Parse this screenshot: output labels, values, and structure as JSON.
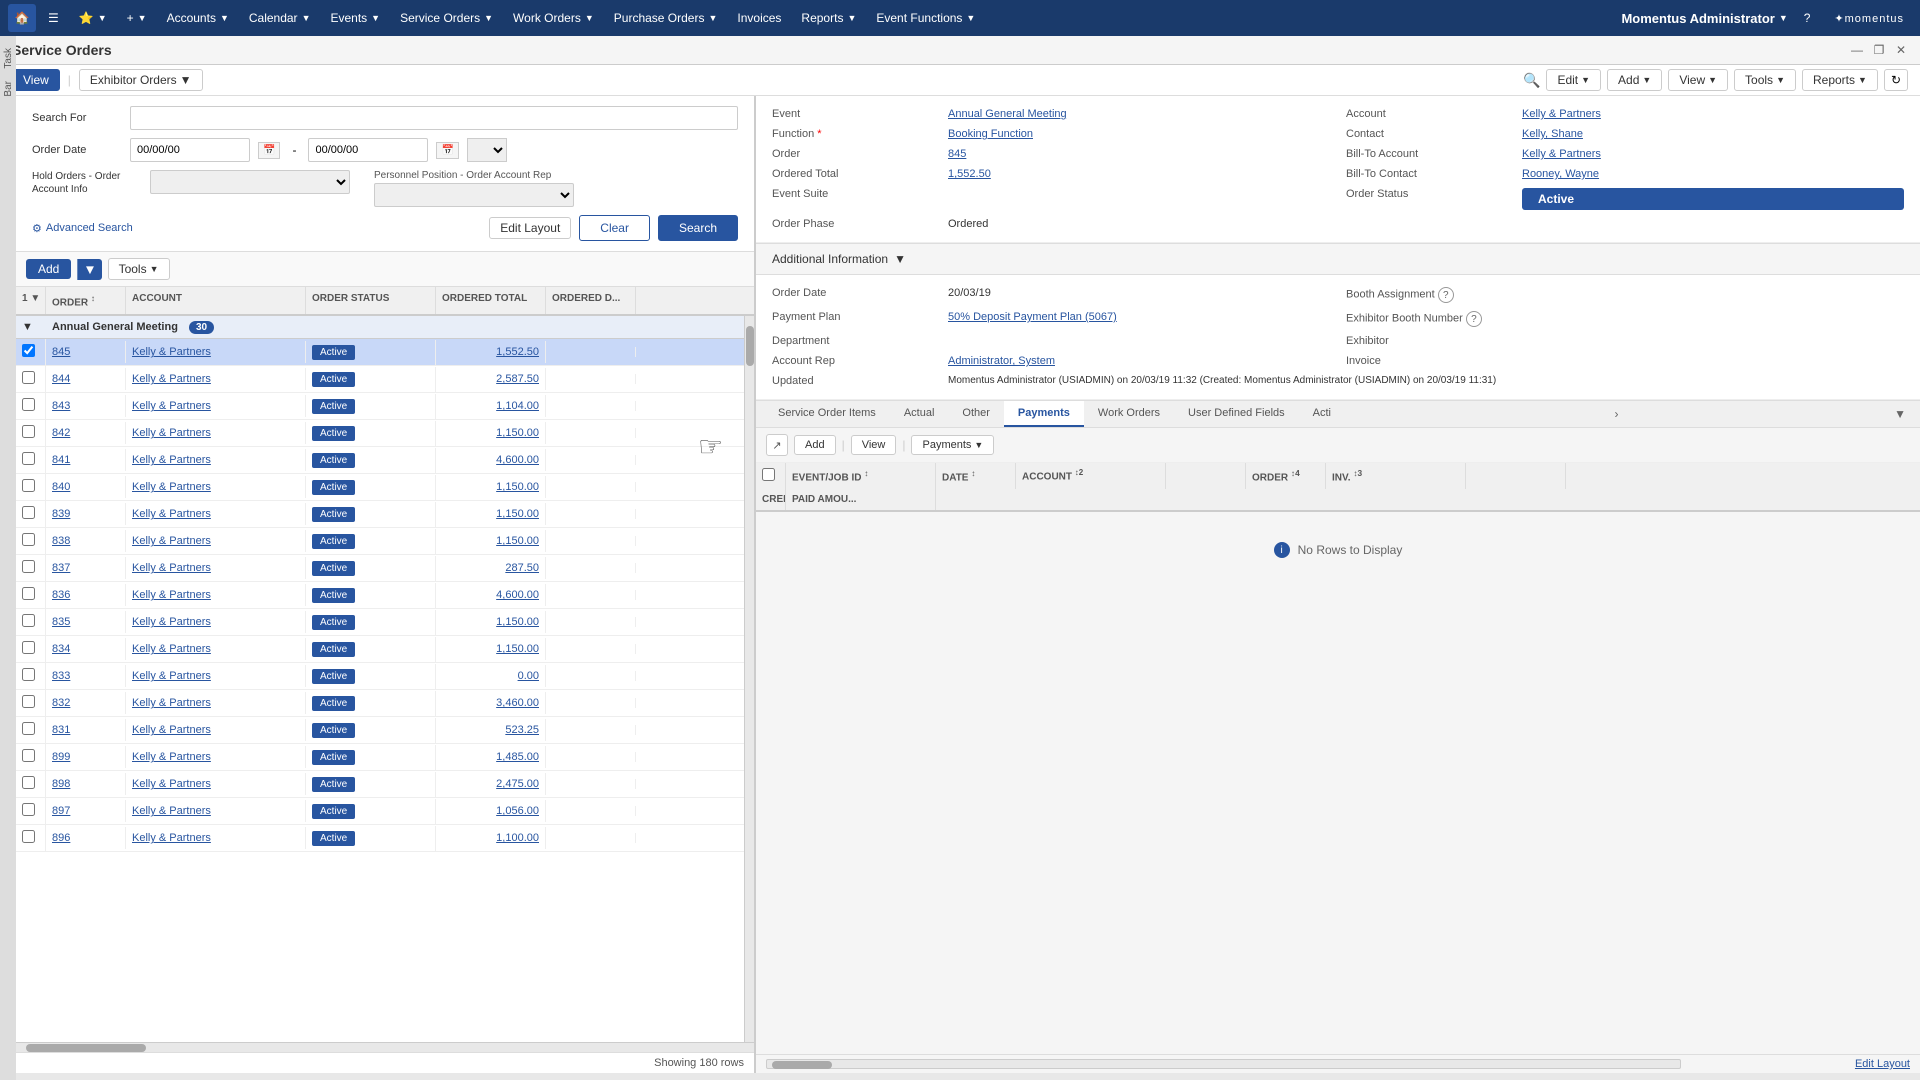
{
  "topNav": {
    "home_icon": "🏠",
    "star_icon": "⭐",
    "plus_icon": "+",
    "items": [
      {
        "label": "Accounts",
        "id": "accounts"
      },
      {
        "label": "Calendar",
        "id": "calendar"
      },
      {
        "label": "Events",
        "id": "events"
      },
      {
        "label": "Service Orders",
        "id": "service-orders"
      },
      {
        "label": "Work Orders",
        "id": "work-orders"
      },
      {
        "label": "Purchase Orders",
        "id": "purchase-orders"
      },
      {
        "label": "Invoices",
        "id": "invoices"
      },
      {
        "label": "Reports",
        "id": "reports"
      },
      {
        "label": "Event Functions",
        "id": "event-functions"
      }
    ],
    "admin_label": "Momentus Administrator",
    "help_icon": "?"
  },
  "window": {
    "title": "Service Orders",
    "view_label": "View",
    "pipe": "|",
    "exhibitor_orders_label": "Exhibitor Orders",
    "toolbar": {
      "edit": "Edit",
      "add": "Add",
      "view": "View",
      "tools": "Tools",
      "reports": "Reports",
      "refresh_icon": "↻"
    }
  },
  "search": {
    "search_for_label": "Search For",
    "order_date_label": "Order Date",
    "hold_orders_label": "Hold Orders - Order Account Info",
    "personnel_label": "Personnel Position - Order Account Rep",
    "date_from_placeholder": "00/00/00",
    "date_to_placeholder": "00/00/00",
    "advanced_search_label": "Advanced Search",
    "clear_label": "Clear",
    "search_label": "Search"
  },
  "resultsToolbar": {
    "add_label": "Add",
    "tools_label": "Tools"
  },
  "grid": {
    "columns": [
      "",
      "ORDER",
      "ACCOUNT",
      "ORDER STATUS",
      "ORDERED TOTAL",
      "ORDERED"
    ],
    "group": {
      "name": "Annual General Meeting",
      "count": "30"
    },
    "rows": [
      {
        "order": "845",
        "account": "Kelly & Partners",
        "status": "Active",
        "total": "1,552.50",
        "selected": true
      },
      {
        "order": "844",
        "account": "Kelly & Partners",
        "status": "Active",
        "total": "2,587.50",
        "selected": false
      },
      {
        "order": "843",
        "account": "Kelly & Partners",
        "status": "Active",
        "total": "1,104.00",
        "selected": false
      },
      {
        "order": "842",
        "account": "Kelly & Partners",
        "status": "Active",
        "total": "1,150.00",
        "selected": false
      },
      {
        "order": "841",
        "account": "Kelly & Partners",
        "status": "Active",
        "total": "4,600.00",
        "selected": false
      },
      {
        "order": "840",
        "account": "Kelly & Partners",
        "status": "Active",
        "total": "1,150.00",
        "selected": false
      },
      {
        "order": "839",
        "account": "Kelly & Partners",
        "status": "Active",
        "total": "1,150.00",
        "selected": false
      },
      {
        "order": "838",
        "account": "Kelly & Partners",
        "status": "Active",
        "total": "1,150.00",
        "selected": false
      },
      {
        "order": "837",
        "account": "Kelly & Partners",
        "status": "Active",
        "total": "287.50",
        "selected": false
      },
      {
        "order": "836",
        "account": "Kelly & Partners",
        "status": "Active",
        "total": "4,600.00",
        "selected": false
      },
      {
        "order": "835",
        "account": "Kelly & Partners",
        "status": "Active",
        "total": "1,150.00",
        "selected": false
      },
      {
        "order": "834",
        "account": "Kelly & Partners",
        "status": "Active",
        "total": "1,150.00",
        "selected": false
      },
      {
        "order": "833",
        "account": "Kelly & Partners",
        "status": "Active",
        "total": "0.00",
        "selected": false
      },
      {
        "order": "832",
        "account": "Kelly & Partners",
        "status": "Active",
        "total": "3,460.00",
        "selected": false
      },
      {
        "order": "831",
        "account": "Kelly & Partners",
        "status": "Active",
        "total": "523.25",
        "selected": false
      },
      {
        "order": "899",
        "account": "Kelly & Partners",
        "status": "Active",
        "total": "1,485.00",
        "selected": false
      },
      {
        "order": "898",
        "account": "Kelly & Partners",
        "status": "Active",
        "total": "2,475.00",
        "selected": false
      },
      {
        "order": "897",
        "account": "Kelly & Partners",
        "status": "Active",
        "total": "1,056.00",
        "selected": false
      },
      {
        "order": "896",
        "account": "Kelly & Partners",
        "status": "Active",
        "total": "1,100.00",
        "selected": false
      }
    ],
    "showing_rows": "Showing 180 rows"
  },
  "detail": {
    "event_label": "Event",
    "event_value": "Annual General Meeting",
    "function_label": "Function",
    "function_value": "Booking Function",
    "order_label": "Order",
    "order_value": "845",
    "ordered_total_label": "Ordered Total",
    "ordered_total_value": "1,552.50",
    "event_suite_label": "Event Suite",
    "event_suite_value": "",
    "order_phase_label": "Order Phase",
    "order_phase_value": "Ordered",
    "account_label": "Account",
    "account_value": "Kelly & Partners",
    "contact_label": "Contact",
    "contact_value": "Kelly, Shane",
    "bill_to_account_label": "Bill-To Account",
    "bill_to_account_value": "Kelly & Partners",
    "bill_to_contact_label": "Bill-To Contact",
    "bill_to_contact_value": "Rooney, Wayne",
    "order_status_label": "Order Status",
    "order_status_value": "Active"
  },
  "additionalInfo": {
    "header": "Additional Information",
    "order_date_label": "Order Date",
    "order_date_value": "20/03/19",
    "booth_assignment_label": "Booth Assignment",
    "payment_plan_label": "Payment Plan",
    "payment_plan_value": "50% Deposit Payment Plan (5067)",
    "exhibitor_booth_label": "Exhibitor Booth Number",
    "department_label": "Department",
    "department_value": "",
    "exhibitor_label": "Exhibitor",
    "account_rep_label": "Account Rep",
    "account_rep_value": "Administrator, System",
    "invoice_label": "Invoice",
    "updated_label": "Updated",
    "updated_value": "Momentus Administrator (USIADMIN) on 20/03/19 11:32 (Created: Momentus Administrator (USIADMIN) on 20/03/19 11:31)"
  },
  "tabs": {
    "items": [
      {
        "label": "Service Order Items",
        "id": "service-order-items"
      },
      {
        "label": "Actual",
        "id": "actual"
      },
      {
        "label": "Other",
        "id": "other"
      },
      {
        "label": "Payments",
        "id": "payments",
        "active": true
      },
      {
        "label": "Work Orders",
        "id": "work-orders"
      },
      {
        "label": "User Defined Fields",
        "id": "user-defined-fields"
      },
      {
        "label": "Acti",
        "id": "acti"
      }
    ]
  },
  "paymentsTab": {
    "add_label": "Add",
    "view_label": "View",
    "pipe": "|",
    "payments_label": "Payments",
    "columns": [
      "",
      "EVENT/JOB ID",
      "DATE",
      "ACCOUNT",
      "",
      "ORDER",
      "INV.",
      "",
      "CREDIT CARD/CHE...",
      "PAID AMOU..."
    ],
    "no_rows_message": "No Rows to Display"
  },
  "editLayout_label": "Edit Layout"
}
